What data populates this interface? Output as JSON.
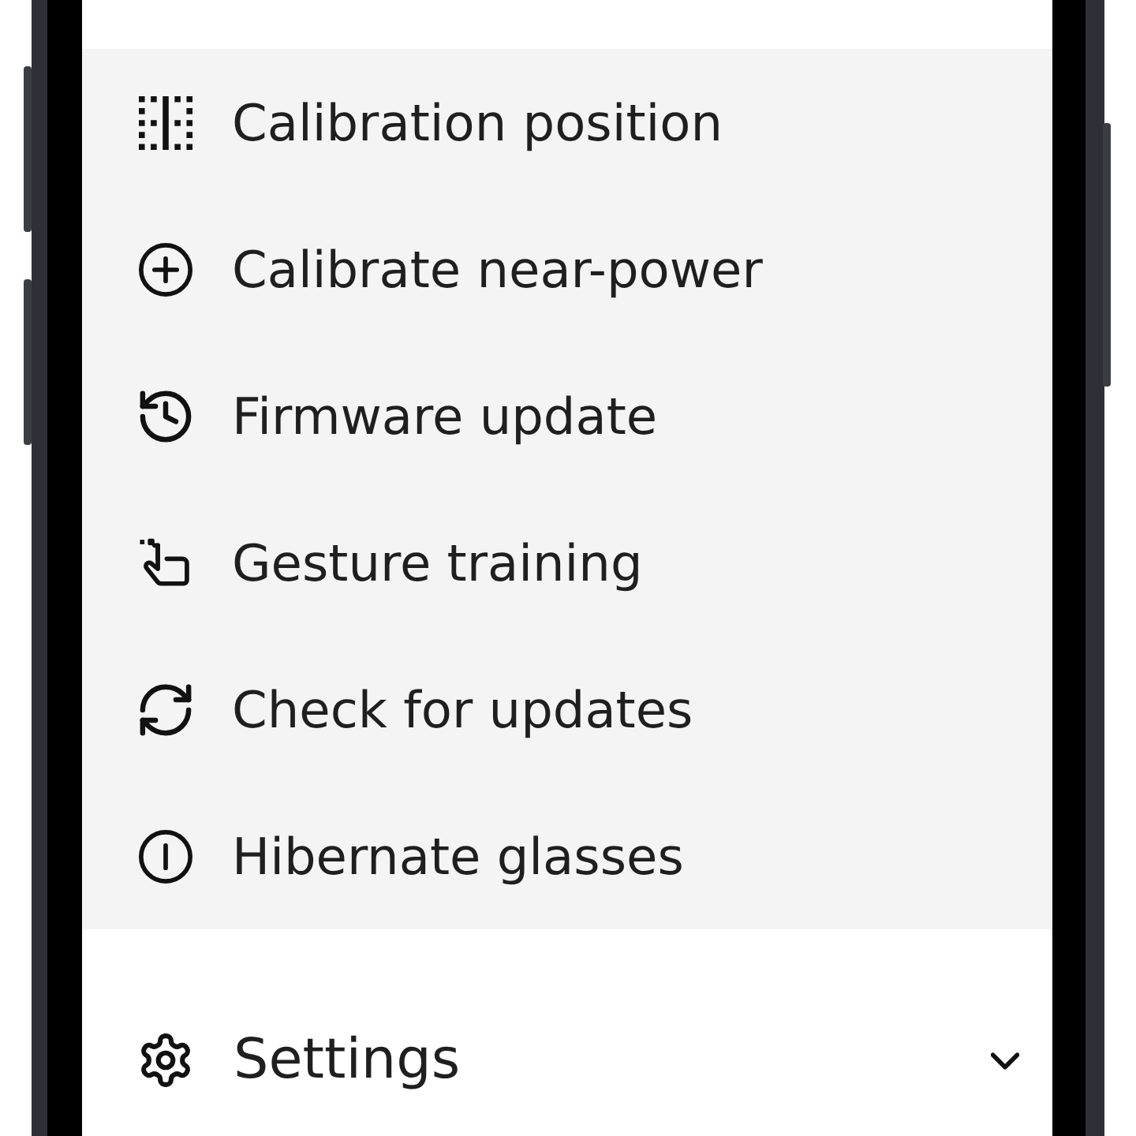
{
  "menu": {
    "items": [
      {
        "label": "Calibration position"
      },
      {
        "label": "Calibrate near-power"
      },
      {
        "label": "Firmware update"
      },
      {
        "label": "Gesture training"
      },
      {
        "label": "Check for updates"
      },
      {
        "label": "Hibernate glasses"
      }
    ]
  },
  "settings": {
    "label": "Settings",
    "expanded": false
  }
}
